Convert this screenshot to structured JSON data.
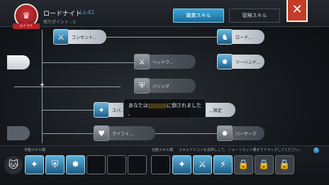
{
  "header": {
    "crest_icon": "guild-crest-icon",
    "crest_tag": "ﾛｰﾄﾞﾅｲﾄ",
    "job_name": "ロードナイト",
    "level": "Lv.42",
    "points_label": "残りポイント",
    "points_sep": " : ",
    "points_value": "0"
  },
  "tabs": [
    {
      "label": "職業スキル",
      "active": true
    },
    {
      "label": "冒険スキル",
      "active": false
    }
  ],
  "close_icon": "close-icon",
  "skills": [
    {
      "name": "コンセント...",
      "icon": "spear-icon",
      "learned": true
    },
    {
      "name": "ロード...",
      "icon": "knight-icon",
      "learned": true
    },
    {
      "name": "ヘッドク...",
      "icon": "slash-icon",
      "learned": false
    },
    {
      "name": "ツーハンド...",
      "icon": "burst-icon",
      "learned": true
    },
    {
      "name": "バリング",
      "icon": "shield-icon",
      "learned": false
    },
    {
      "name": "スパ...",
      "icon": "wind-icon",
      "learned": true
    },
    {
      "name": "...限定",
      "icon": "aura-icon",
      "learned": true
    },
    {
      "name": "ライフイ...",
      "icon": "life-icon",
      "learned": false
    },
    {
      "name": "バーサーク",
      "icon": "berserk-icon",
      "learned": false
    }
  ],
  "toast": {
    "line1_prefix": "あなたは",
    "line1_suffix": "に倒されました",
    "line2": "。"
  },
  "bottom": {
    "manual_label": "手動スキル欄",
    "auto_label": "自動スキル欄",
    "hint": "スキルアイコンを長押しして、ショートカット欄までドラッグしてください。",
    "info_icon": "info-icon",
    "pet_icon": "cat-icon",
    "manual_slots": [
      "skill-a-icon",
      "skill-b-icon",
      "skill-c-icon",
      "",
      "",
      "",
      "",
      ""
    ],
    "auto_slots": [
      "skill-d-icon",
      "skill-e-icon",
      "skill-f-icon",
      "lock-icon",
      "lock-icon",
      "lock-icon"
    ]
  }
}
